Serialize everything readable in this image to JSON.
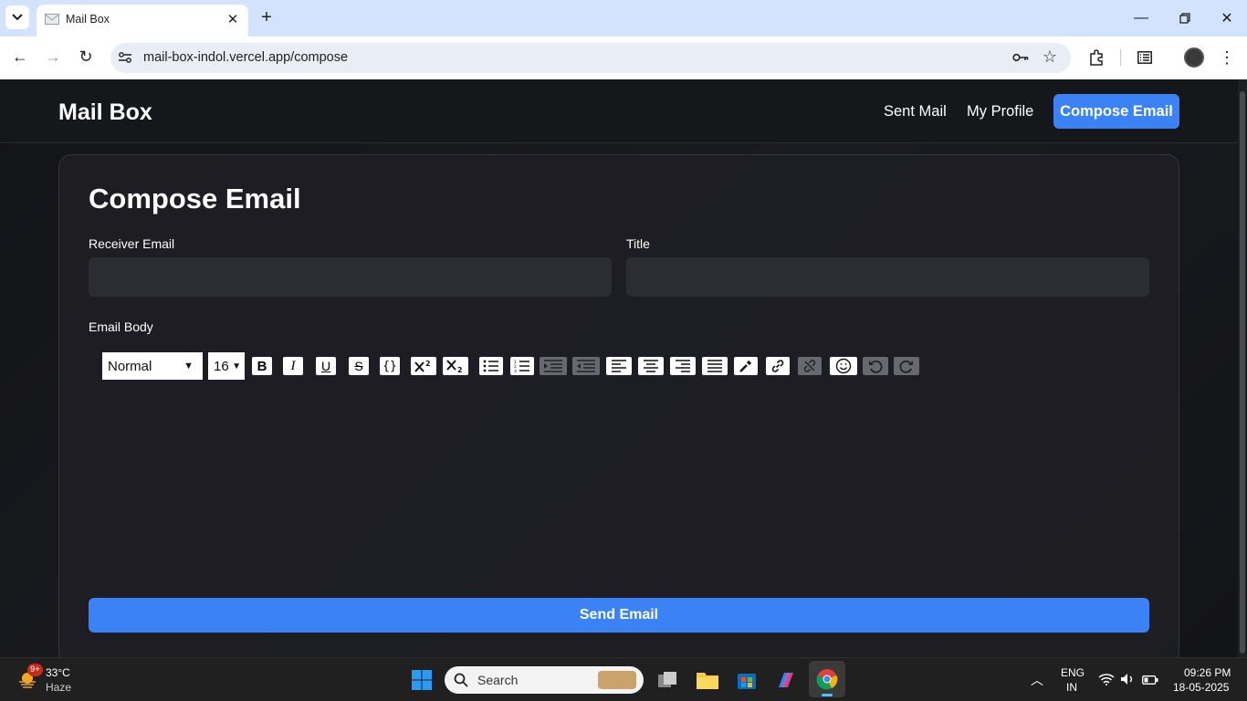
{
  "browser": {
    "tab_title": "Mail Box",
    "url": "mail-box-indol.vercel.app/compose"
  },
  "app": {
    "brand": "Mail Box",
    "nav": {
      "sent": "Sent Mail",
      "profile": "My Profile",
      "compose": "Compose Email"
    },
    "page_title": "Compose Email",
    "fields": {
      "receiver_label": "Receiver Email",
      "receiver_value": "",
      "title_label": "Title",
      "title_value": "",
      "body_label": "Email Body"
    },
    "editor": {
      "block_type": "Normal",
      "font_size": "16"
    },
    "send_label": "Send Email",
    "colors": {
      "accent": "#3b82f6"
    }
  },
  "taskbar": {
    "weather_temp": "33°C",
    "weather_desc": "Haze",
    "weather_badge": "9+",
    "search_placeholder": "Search",
    "lang": "ENG",
    "region": "IN",
    "time": "09:26 PM",
    "date": "18-05-2025"
  }
}
